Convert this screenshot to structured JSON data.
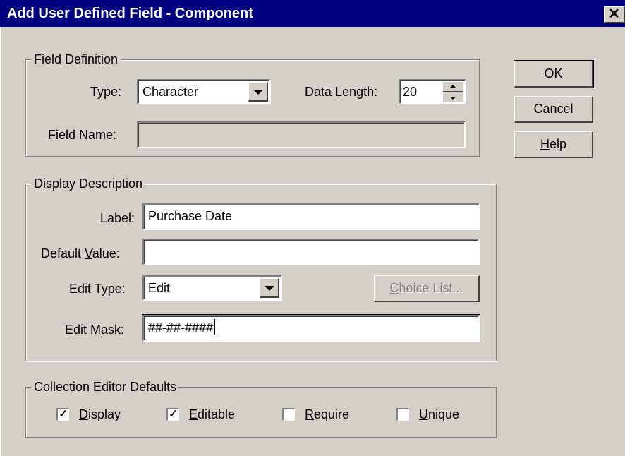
{
  "window": {
    "title": "Add User Defined Field - Component",
    "close_glyph": "✕"
  },
  "field_definition": {
    "legend": "Field Definition",
    "type_label_pre": "",
    "type_label_u": "T",
    "type_label_post": "ype:",
    "type_value": "Character",
    "data_length_label_pre": "Data ",
    "data_length_label_u": "L",
    "data_length_label_post": "ength:",
    "data_length_value": "20",
    "field_name_label_u": "F",
    "field_name_label_post": "ield Name:",
    "field_name_value": ""
  },
  "display_description": {
    "legend": "Display Description",
    "label_label": "Label:",
    "label_value": "Purchase Date",
    "default_value_label_pre": "Default ",
    "default_value_label_u": "V",
    "default_value_label_post": "alue:",
    "default_value_value": "",
    "edit_type_label_pre": "Ed",
    "edit_type_label_u": "i",
    "edit_type_label_post": "t Type:",
    "edit_type_value": "Edit",
    "choice_list_u": "C",
    "choice_list_post": "hoice List...",
    "edit_mask_label_pre": "Edit ",
    "edit_mask_label_u": "M",
    "edit_mask_label_post": "ask:",
    "edit_mask_value": "##-##-####"
  },
  "collection_defaults": {
    "legend": "Collection Editor Defaults",
    "items": [
      {
        "u": "D",
        "post": "isplay",
        "checked": true
      },
      {
        "u": "E",
        "post": "ditable",
        "checked": true
      },
      {
        "u": "R",
        "post": "equire",
        "checked": false
      },
      {
        "u": "U",
        "post": "nique",
        "checked": false
      }
    ],
    "check_glyph": "✓"
  },
  "buttons": {
    "ok": "OK",
    "cancel": "Cancel",
    "help_u": "H",
    "help_post": "elp"
  }
}
